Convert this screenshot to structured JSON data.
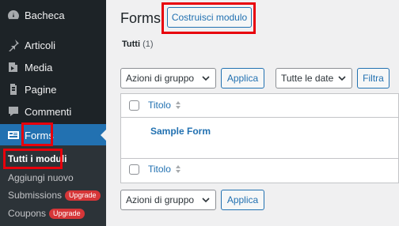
{
  "sidebar": {
    "items": [
      {
        "label": "Bacheca",
        "icon": "dashboard-icon"
      },
      {
        "label": "Articoli",
        "icon": "pin-icon"
      },
      {
        "label": "Media",
        "icon": "media-icon"
      },
      {
        "label": "Pagine",
        "icon": "page-icon"
      },
      {
        "label": "Commenti",
        "icon": "comment-icon"
      },
      {
        "label": "Forms",
        "icon": "forms-icon"
      }
    ],
    "submenu": [
      {
        "label": "Tutti i moduli"
      },
      {
        "label": "Aggiungi nuovo"
      },
      {
        "label": "Submissions",
        "badge": "Upgrade"
      },
      {
        "label": "Coupons",
        "badge": "Upgrade"
      }
    ]
  },
  "main": {
    "title": "Forms",
    "build_button": "Costruisci modulo",
    "filter_label": "Tutti",
    "filter_count": "(1)",
    "bulk_action_top": "Azioni di gruppo",
    "apply_top": "Applica",
    "date_filter": "Tutte le date",
    "filter_button": "Filtra",
    "column_title": "Titolo",
    "rows": [
      {
        "title": "Sample Form"
      }
    ],
    "column_title_footer": "Titolo",
    "bulk_action_bottom": "Azioni di gruppo",
    "apply_bottom": "Applica"
  },
  "colors": {
    "accent": "#2271b1",
    "highlight": "#e8000b",
    "sidebar": "#1d2327",
    "upgrade": "#d63638"
  }
}
